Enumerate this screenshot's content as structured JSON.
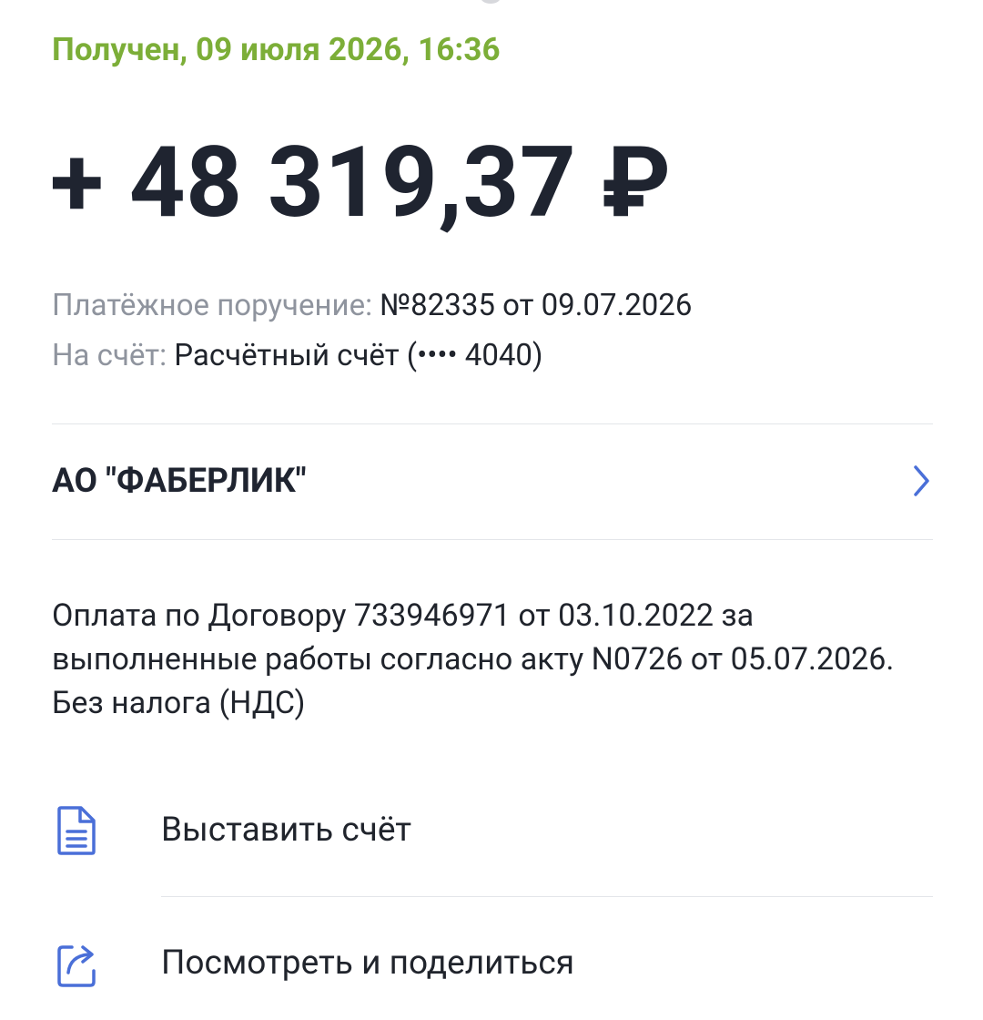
{
  "transaction": {
    "status": "Получен, 09 июля 2026, 16:36",
    "amount": "+ 48 319,37 ₽",
    "payment_order_label": "Платёжное поручение:",
    "payment_order_value": "№82335 от 09.07.2026",
    "account_label": "На счёт:",
    "account_value": "Расчётный счёт (•••• 4040)"
  },
  "counterparty": {
    "name": "АО \"ФАБЕРЛИК\"",
    "icon": "chevron-right-icon"
  },
  "purpose": {
    "text": "Оплата по Договору 733946971 от 03.10.2022 за выполненные работы согласно акту N0726 от 05.07.2026. Без налога (НДС)"
  },
  "actions": [
    {
      "label": "Выставить счёт",
      "icon": "invoice-document-icon"
    },
    {
      "label": "Посмотреть и поделиться",
      "icon": "share-icon"
    }
  ],
  "colors": {
    "status_green": "#7CAE38",
    "accent_blue": "#4A6FD8",
    "text_primary": "#1F2430",
    "text_secondary": "#8F949E",
    "divider": "#E3E5E9"
  }
}
